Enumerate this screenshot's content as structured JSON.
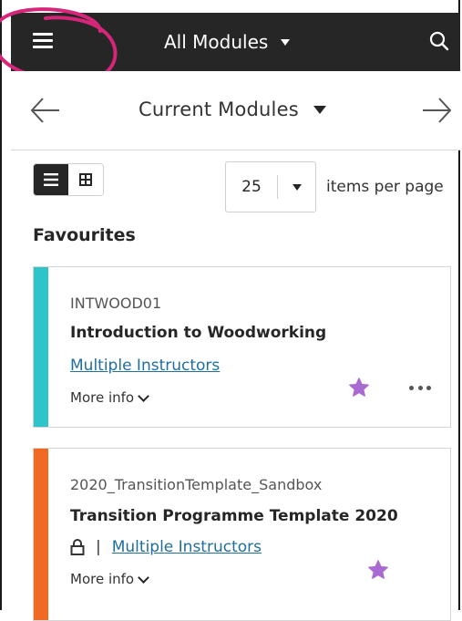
{
  "header": {
    "title": "All Modules",
    "menu_icon": "hamburger-menu-icon",
    "search_icon": "search-icon",
    "background": "#262626"
  },
  "term_nav": {
    "current_term": "Current Modules",
    "prev_icon": "arrow-left-icon",
    "next_icon": "arrow-right-icon"
  },
  "view_toggle": {
    "list_icon": "list-view-icon",
    "grid_icon": "grid-view-icon",
    "active": "list"
  },
  "pagination": {
    "items_per_page": "25",
    "label": "items per page"
  },
  "favourites": {
    "heading": "Favourites",
    "courses": [
      {
        "code": "INTWOOD01",
        "title": "Introduction to Woodworking",
        "instructors": "Multiple Instructors",
        "more_info": "More info",
        "accent": "#2ec4c9",
        "favourite": true,
        "locked": false
      },
      {
        "code": "2020_TransitionTemplate_Sandbox",
        "title": "Transition Programme Template 2020",
        "separator": "|",
        "instructors": "Multiple Instructors",
        "more_info": "More info",
        "accent": "#f26a21",
        "favourite": true,
        "locked": true
      }
    ]
  },
  "colors": {
    "star": "#a96bd1",
    "link": "#1f6f9e",
    "annotation": "#d6267a"
  }
}
